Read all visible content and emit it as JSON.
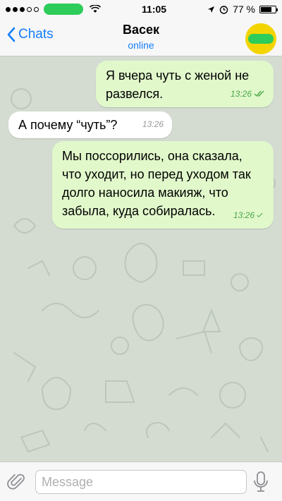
{
  "status_bar": {
    "time": "11:05",
    "battery": "77 %",
    "battery_level": 0.77,
    "signal_dots": 5,
    "signal_filled": 3,
    "icons": [
      "wifi-icon",
      "location-arrow-icon",
      "alarm-icon",
      "battery-icon"
    ]
  },
  "nav": {
    "back_label": "Chats",
    "title": "Васек",
    "status": "online",
    "avatar_color": "#f4d400",
    "link_color": "#147efb"
  },
  "messages": [
    {
      "direction": "outgoing",
      "text": "Я вчера чуть с женой не развелся.",
      "time": "13:26",
      "status": "read",
      "icon": "double-check-icon"
    },
    {
      "direction": "incoming",
      "text": "А почему “чуть”?",
      "time": "13:26"
    },
    {
      "direction": "outgoing",
      "text": "Мы поссорились, она сказала, что уходит, но перед уходом так долго наносила макияж, что забыла, куда собиралась.",
      "time": "13:26",
      "status": "sent",
      "icon": "check-icon"
    }
  ],
  "colors": {
    "outgoing_bubble": "#e1f8cb",
    "incoming_bubble": "#ffffff",
    "chat_background": "#d4dcd2",
    "check_color": "#4aa84a"
  },
  "input": {
    "placeholder": "Message",
    "value": "",
    "icons": [
      "paperclip-icon",
      "microphone-icon"
    ]
  }
}
